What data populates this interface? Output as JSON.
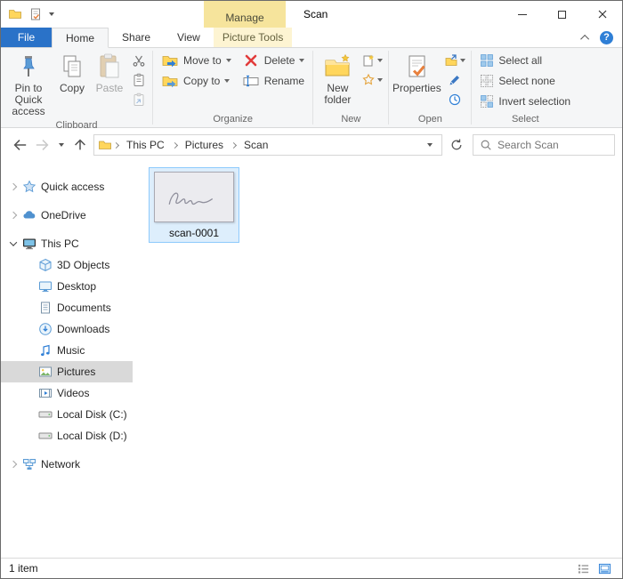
{
  "colors": {
    "file_tab_blue": "#2a72c8",
    "manage_yellow": "#f6e49c",
    "picture_tools_bg": "#fdf4d2",
    "accent_blue": "#2f7fd6",
    "selection_fill": "#ddeefc",
    "selection_border": "#8ecafc",
    "nav_selected": "#d9d9d9"
  },
  "icons": {
    "help": "?"
  },
  "titlebar": {
    "manage_label": "Manage",
    "title": "Scan"
  },
  "tabs": {
    "file": "File",
    "home": "Home",
    "share": "Share",
    "view": "View",
    "picture_tools": "Picture Tools"
  },
  "ribbon": {
    "clipboard": {
      "group_label": "Clipboard",
      "pin_to_quick_access": "Pin to Quick access",
      "copy": "Copy",
      "paste": "Paste"
    },
    "organize": {
      "group_label": "Organize",
      "move_to": "Move to",
      "copy_to": "Copy to",
      "delete": "Delete",
      "rename": "Rename"
    },
    "new": {
      "group_label": "New",
      "new_folder": "New folder"
    },
    "open": {
      "group_label": "Open",
      "properties": "Properties"
    },
    "select": {
      "group_label": "Select",
      "select_all": "Select all",
      "select_none": "Select none",
      "invert_selection": "Invert selection"
    }
  },
  "addressbar": {
    "crumbs": [
      "This PC",
      "Pictures",
      "Scan"
    ],
    "search_placeholder": "Search Scan"
  },
  "sidebar": {
    "items": [
      {
        "label": "Quick access"
      },
      {
        "label": "OneDrive"
      },
      {
        "label": "This PC"
      },
      {
        "label": "3D Objects"
      },
      {
        "label": "Desktop"
      },
      {
        "label": "Documents"
      },
      {
        "label": "Downloads"
      },
      {
        "label": "Music"
      },
      {
        "label": "Pictures"
      },
      {
        "label": "Videos"
      },
      {
        "label": "Local Disk (C:)"
      },
      {
        "label": "Local Disk (D:)"
      },
      {
        "label": "Network"
      }
    ]
  },
  "content": {
    "files": [
      {
        "name": "scan-0001",
        "selected": true
      }
    ]
  },
  "statusbar": {
    "item_count": "1 item"
  }
}
